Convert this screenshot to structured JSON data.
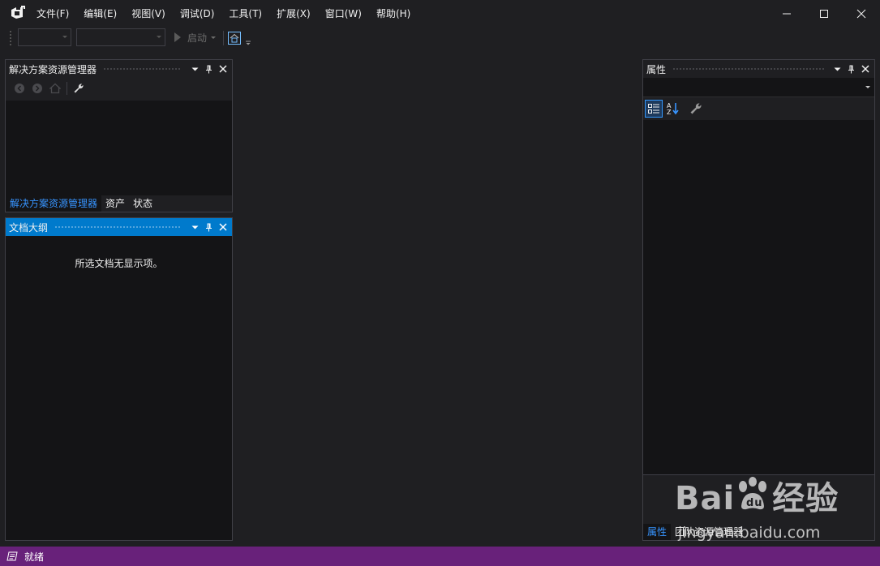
{
  "menu": {
    "items": [
      "文件(F)",
      "编辑(E)",
      "视图(V)",
      "调试(D)",
      "工具(T)",
      "扩展(X)",
      "窗口(W)",
      "帮助(H)"
    ]
  },
  "toolbar": {
    "start_label": "启动"
  },
  "solution_explorer": {
    "title": "解决方案资源管理器",
    "tabs": [
      "解决方案资源管理器",
      "资产",
      "状态"
    ]
  },
  "document_outline": {
    "title": "文档大纲",
    "empty_message": "所选文档无显示项。"
  },
  "properties": {
    "title": "属性",
    "tabs": [
      "属性",
      "团队资源管理器"
    ]
  },
  "status_bar": {
    "text": "就绪",
    "color": "#68217a"
  },
  "watermark": {
    "brand": "Bai",
    "brand_suffix": "经验",
    "url": "jingyan.baidu.com"
  },
  "colors": {
    "accent": "#007acc",
    "active_tab_text": "#3794ff",
    "background": "#1f1f22"
  }
}
